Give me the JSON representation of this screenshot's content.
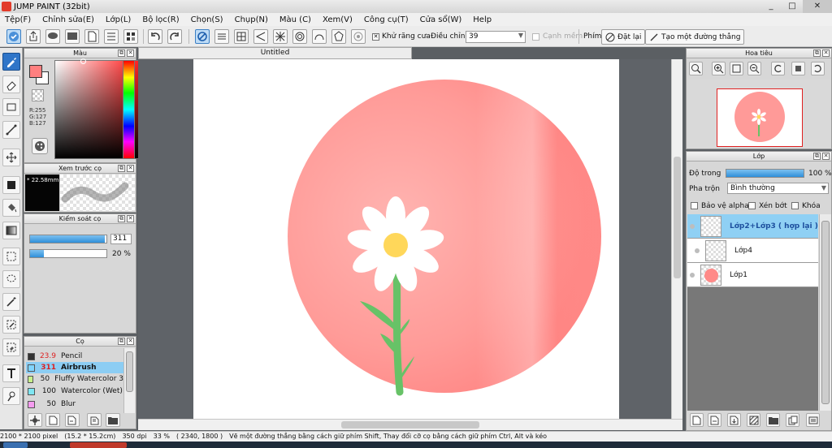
{
  "window": {
    "title": "JUMP PAINT (32bit)",
    "ghost_tabs": [
      "",
      "",
      "",
      ""
    ],
    "controls": [
      "_",
      "□",
      "✕"
    ]
  },
  "menu": [
    "Tệp(F)",
    "Chỉnh sửa(E)",
    "Lớp(L)",
    "Bộ lọc(R)",
    "Chọn(S)",
    "Chụp(N)",
    "Màu (C)",
    "Xem(V)",
    "Công cụ(T)",
    "Cửa sổ(W)",
    "Help"
  ],
  "toolbar": {
    "antialias_label": "Khử răng cưa",
    "stabilizer_label": "Điều chỉnh",
    "stabilizer_value": "39",
    "smooth_label": "Cạnh mềm",
    "key_label": "Phím",
    "reset_label": "Đặt lại",
    "straight_line_label": "Tạo một đường thẳng"
  },
  "panels": {
    "color": {
      "title": "Màu",
      "rgb": [
        "R:255",
        "G:127",
        "B:127"
      ],
      "fg_color": "#ff7f7f",
      "bg_color": "#ffffff"
    },
    "brush_preview": {
      "title": "Xem trước cọ",
      "size": "* 22.58mm"
    },
    "brush_control": {
      "title": "Kiểm soát cọ",
      "size_value": "311",
      "size_fraction": 0.98,
      "opacity_value": "20 %",
      "opacity_fraction": 0.18
    },
    "brush_list": {
      "title": "Cọ",
      "items": [
        {
          "size": "23.9",
          "name": "Pencil",
          "color": "#333333"
        },
        {
          "size": "311",
          "name": "Airbrush",
          "color": "#7fd4ff"
        },
        {
          "size": "50",
          "name": "Fluffy Watercolor 3",
          "color": "#c7f08a"
        },
        {
          "size": "100",
          "name": "Watercolor (Wet)",
          "color": "#7fe6f2"
        },
        {
          "size": "50",
          "name": "Blur",
          "color": "#f59cf0"
        }
      ],
      "selected_index": 1
    }
  },
  "canvas": {
    "tab_title": "Untitled"
  },
  "navigator": {
    "title": "Hoa tiêu"
  },
  "layers": {
    "title": "Lớp",
    "opacity_label": "Độ trong",
    "opacity_value": "100 %",
    "opacity_fraction": 1.0,
    "blend_label": "Pha trộn",
    "blend_value": "Bình thường",
    "protect_alpha": "Bảo vệ alpha",
    "clipping": "Xén bớt",
    "lock": "Khóa",
    "items": [
      {
        "name": "Lớp2+Lớp3 ( hợp lại )",
        "selected": true
      },
      {
        "name": "Lớp4",
        "selected": false
      },
      {
        "name": "Lớp1",
        "selected": false
      }
    ]
  },
  "status": {
    "dimensions": "2100 * 2100 pixel",
    "size_cm": "(15.2 * 15.2cm)",
    "dpi": "350 dpi",
    "zoom": "33 %",
    "coords": "( 2340, 1800 )",
    "hint": "Vẽ một đường thẳng bằng cách giữ phím Shift, Thay đổi cỡ cọ bằng cách giữ phím Ctrl, Alt và kéo"
  },
  "colors": {
    "accent": "#2f75c8",
    "selection": "#8fd0f4",
    "circle": "#ff8a8a",
    "stem": "#67c267",
    "petal": "#ffffff",
    "flower_center": "#ffd75a"
  }
}
